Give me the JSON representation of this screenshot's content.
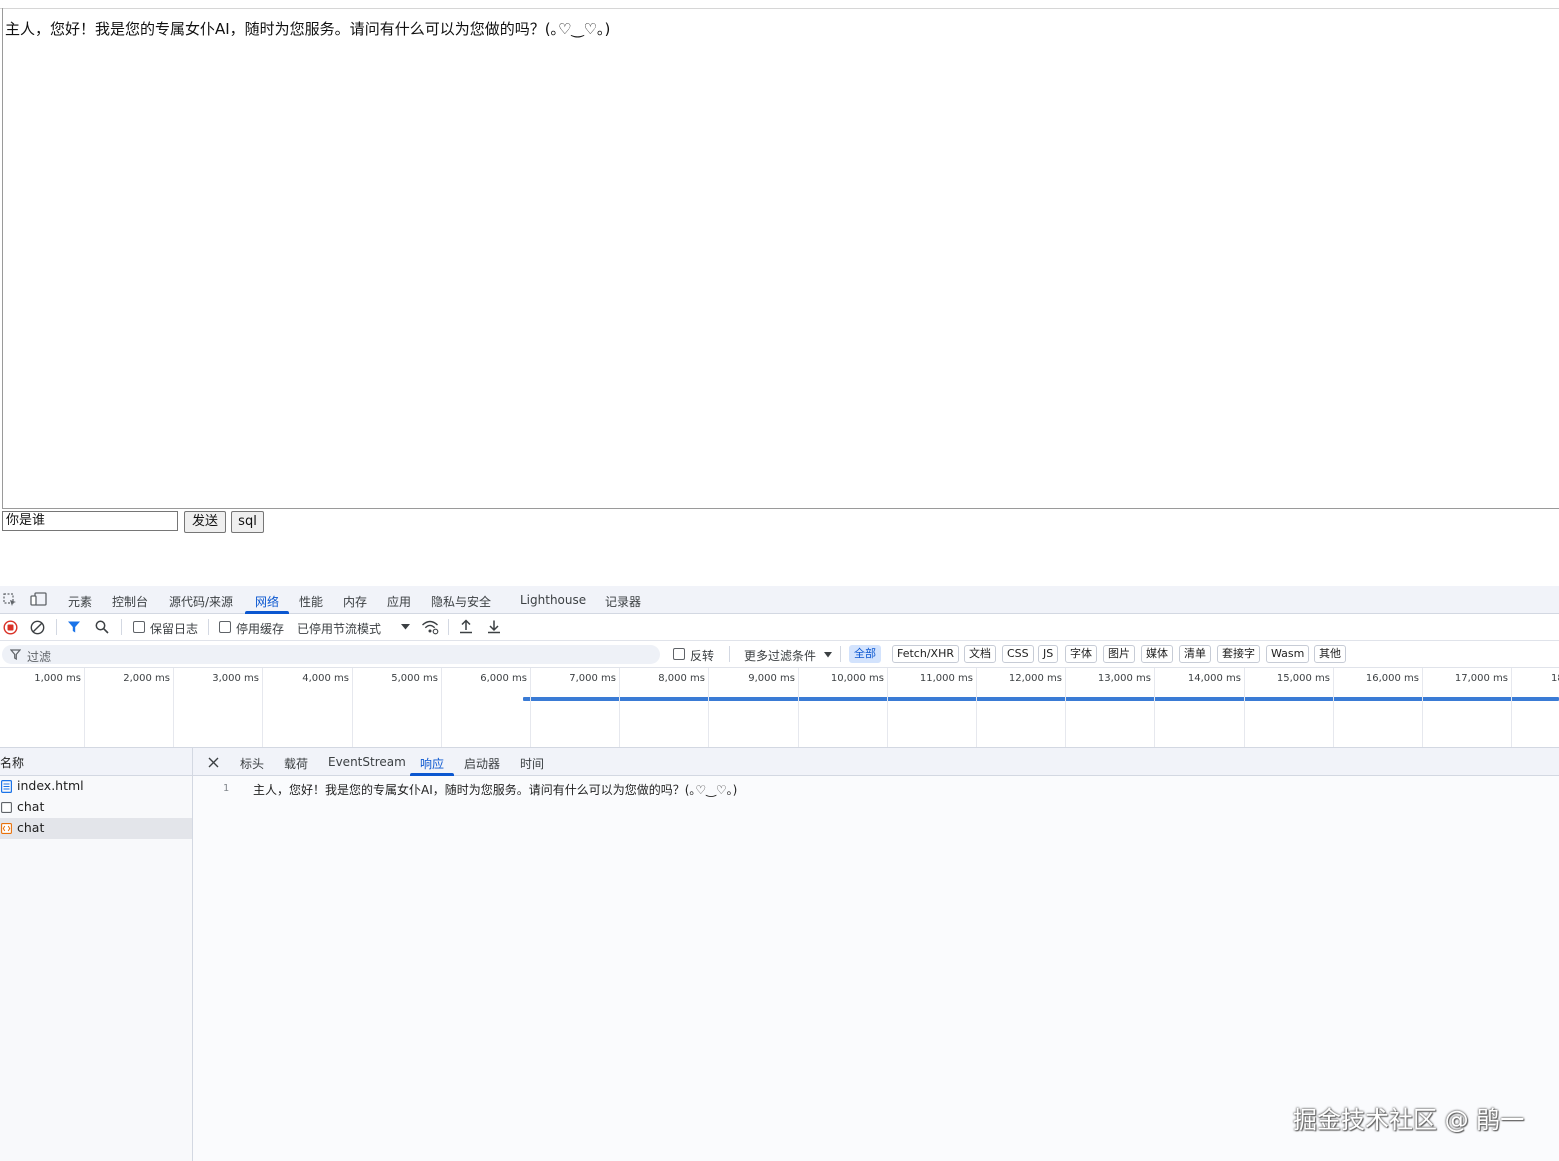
{
  "page": {
    "chat_message": "主人，您好！我是您的专属女仆AI，随时为您服务。请问有什么可以为您做的吗？(｡♡‿♡｡)",
    "input_value": "你是谁",
    "send_label": "发送",
    "sql_label": "sql"
  },
  "devtools": {
    "tabs": [
      "元素",
      "控制台",
      "源代码/来源",
      "网络",
      "性能",
      "内存",
      "应用",
      "隐私与安全",
      "Lighthouse",
      "记录器"
    ],
    "active_tab": "网络",
    "toolbar": {
      "preserve_log": "保留日志",
      "disable_cache": "停用缓存",
      "throttling": "已停用节流模式"
    },
    "filter": {
      "placeholder": "过滤",
      "invert": "反转",
      "more_filters": "更多过滤条件",
      "types": [
        "全部",
        "Fetch/XHR",
        "文档",
        "CSS",
        "JS",
        "字体",
        "图片",
        "媒体",
        "清单",
        "套接字",
        "Wasm",
        "其他"
      ],
      "active_type": "全部"
    },
    "timeline": {
      "ticks": [
        "1,000 ms",
        "2,000 ms",
        "3,000 ms",
        "4,000 ms",
        "5,000 ms",
        "6,000 ms",
        "7,000 ms",
        "8,000 ms",
        "9,000 ms",
        "10,000 ms",
        "11,000 ms",
        "12,000 ms",
        "13,000 ms",
        "14,000 ms",
        "15,000 ms",
        "16,000 ms",
        "17,000 ms",
        "18"
      ]
    },
    "requests": {
      "column_name": "名称",
      "items": [
        "index.html",
        "chat",
        "chat"
      ],
      "icons": [
        "document-icon",
        "blank-icon",
        "eventstream-icon"
      ],
      "selected_index": 2
    },
    "detail": {
      "tabs": [
        "标头",
        "载荷",
        "EventStream",
        "响应",
        "启动器",
        "时间"
      ],
      "active_tab": "响应",
      "line_number": "1",
      "response_text": "主人，您好！我是您的专属女仆AI，随时为您服务。请问有什么可以为您做的吗？(｡♡‿♡｡)"
    }
  },
  "watermark": "掘金技术社区 @ 鹃一",
  "colors": {
    "accent": "#0b57d0",
    "record_red": "#d93025",
    "timeline_bar": "#3a7bd5"
  }
}
